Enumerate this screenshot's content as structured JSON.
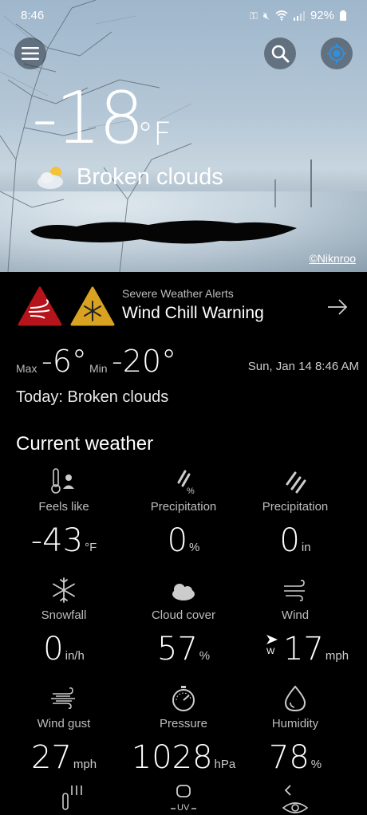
{
  "status_bar": {
    "time": "8:46",
    "battery": "92%",
    "icons": [
      "key-icon",
      "mute-icon",
      "wifi-icon",
      "signal-icon",
      "battery-icon"
    ]
  },
  "toolbar": {
    "menu_icon": "hamburger-menu-icon",
    "search_icon": "search-icon",
    "location_icon": "location-target-icon"
  },
  "hero": {
    "temperature": "-18",
    "unit": "°F",
    "condition": "Broken clouds",
    "condition_icon": "partly-cloudy-icon",
    "photo_credit": "©Niknroo"
  },
  "alerts": {
    "subtitle": "Severe Weather Alerts",
    "title": "Wind Chill Warning",
    "icons": [
      "wind-warning-icon",
      "cold-warning-icon"
    ],
    "colors": {
      "wind": "#b5141a",
      "cold": "#d9a321"
    }
  },
  "summary": {
    "max_label": "Max",
    "max_value": "-6°",
    "min_label": "Min",
    "min_value": "-20°",
    "datetime": "Sun, Jan 14 8:46 AM",
    "today_text": "Today: Broken clouds"
  },
  "current": {
    "section_title": "Current weather",
    "items": [
      {
        "label": "Feels like",
        "value": "-43",
        "unit": "°F",
        "icon": "thermometer-person-icon"
      },
      {
        "label": "Precipitation",
        "value": "0",
        "unit": "%",
        "icon": "rain-percent-icon"
      },
      {
        "label": "Precipitation",
        "value": "0",
        "unit": "in",
        "icon": "rain-icon"
      },
      {
        "label": "Snowfall",
        "value": "0",
        "unit": "in/h",
        "icon": "snowflake-icon"
      },
      {
        "label": "Cloud cover",
        "value": "57",
        "unit": "%",
        "icon": "cloud-icon"
      },
      {
        "label": "Wind",
        "value": "17",
        "unit": "mph",
        "direction": "W",
        "icon": "wind-icon"
      },
      {
        "label": "Wind gust",
        "value": "27",
        "unit": "mph",
        "icon": "wind-gust-icon"
      },
      {
        "label": "Pressure",
        "value": "1028",
        "unit": "hPa",
        "icon": "gauge-icon"
      },
      {
        "label": "Humidity",
        "value": "78",
        "unit": "%",
        "icon": "droplet-icon"
      }
    ],
    "partial_row": {
      "uv_label": "UV",
      "icons": [
        "rain-thermometer-icon",
        "uv-icon",
        "visibility-eye-icon"
      ]
    }
  }
}
